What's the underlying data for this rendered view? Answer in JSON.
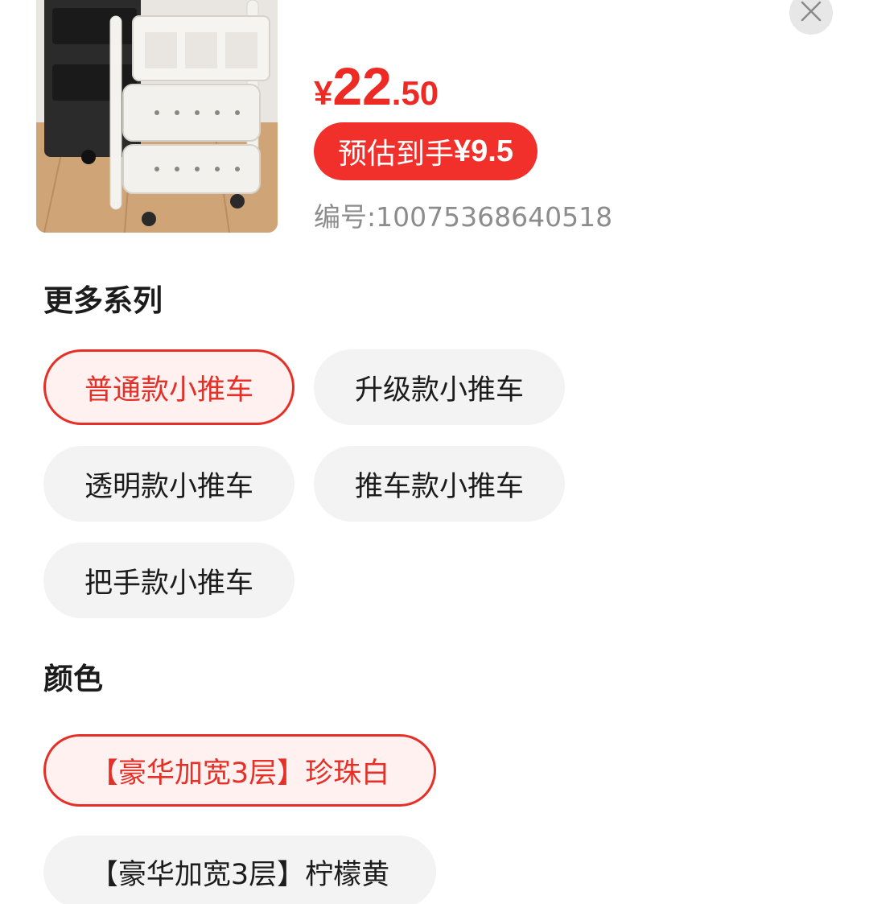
{
  "product": {
    "price_symbol": "¥",
    "price_integer": "22",
    "price_decimal": ".50",
    "estimate_label": "预估到手",
    "estimate_value": "¥9.5",
    "sku_label": "编号:",
    "sku_number": "10075368640518"
  },
  "series": {
    "title": "更多系列",
    "options": [
      {
        "label": "普通款小推车",
        "selected": true
      },
      {
        "label": "升级款小推车",
        "selected": false
      },
      {
        "label": "透明款小推车",
        "selected": false
      },
      {
        "label": "推车款小推车",
        "selected": false
      },
      {
        "label": "把手款小推车",
        "selected": false
      }
    ]
  },
  "color": {
    "title": "颜色",
    "options": [
      {
        "label": "【豪华加宽3层】珍珠白",
        "selected": true
      },
      {
        "label": "【豪华加宽3层】柠檬黄",
        "selected": false
      }
    ]
  },
  "icons": {
    "close": "close-icon"
  },
  "colors": {
    "accent": "#ee2a24",
    "badge": "#f2302b",
    "chip_bg": "#f3f3f3",
    "chip_selected_bg": "#fff1ef",
    "muted_text": "#8c8c8c"
  }
}
